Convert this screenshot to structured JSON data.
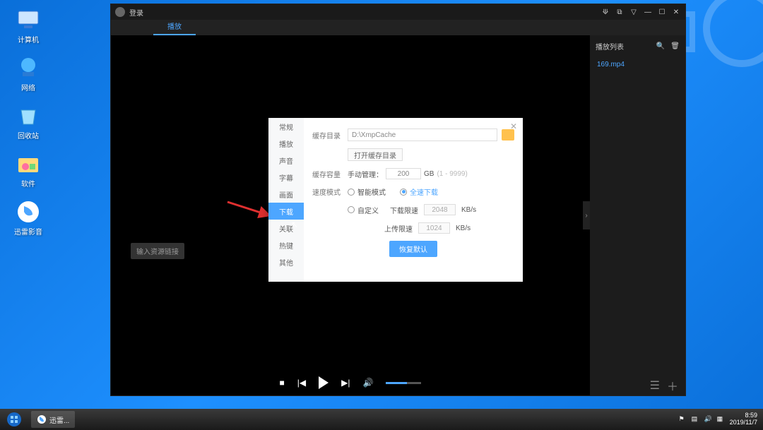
{
  "desktop": {
    "icons": [
      {
        "label": "计算机"
      },
      {
        "label": "网络"
      },
      {
        "label": "回收站"
      },
      {
        "label": "软件"
      },
      {
        "label": "迅雷影音"
      }
    ]
  },
  "taskbar": {
    "app_running": "迅雷...",
    "time": "8:59",
    "date": "2019/11/7"
  },
  "app": {
    "login": "登录",
    "tab": "播放",
    "search_hint": "输入资源链接",
    "playlist_header": "播放列表",
    "playlist_item": "169.mp4",
    "side_handle": "›"
  },
  "settings": {
    "nav": [
      "常规",
      "播放",
      "声音",
      "字幕",
      "画面",
      "下载",
      "关联",
      "热键",
      "其他"
    ],
    "active_index": 5,
    "cache_dir_label": "缓存目录",
    "cache_dir_value": "D:\\XmpCache",
    "open_dir_btn": "打开缓存目录",
    "cache_cap_label": "缓存容量",
    "cache_cap_prefix": "手动管理：",
    "cache_cap_value": "200",
    "cache_cap_unit": "GB",
    "cache_cap_range": "(1 - 9999)",
    "speed_mode_label": "速度模式",
    "smart_mode": "智能模式",
    "full_speed": "全速下载",
    "custom": "自定义",
    "dl_limit_label": "下载限速",
    "dl_limit_value": "2048",
    "ul_limit_label": "上传限速",
    "ul_limit_value": "1024",
    "unit": "KB/s",
    "restore": "恢复默认"
  }
}
